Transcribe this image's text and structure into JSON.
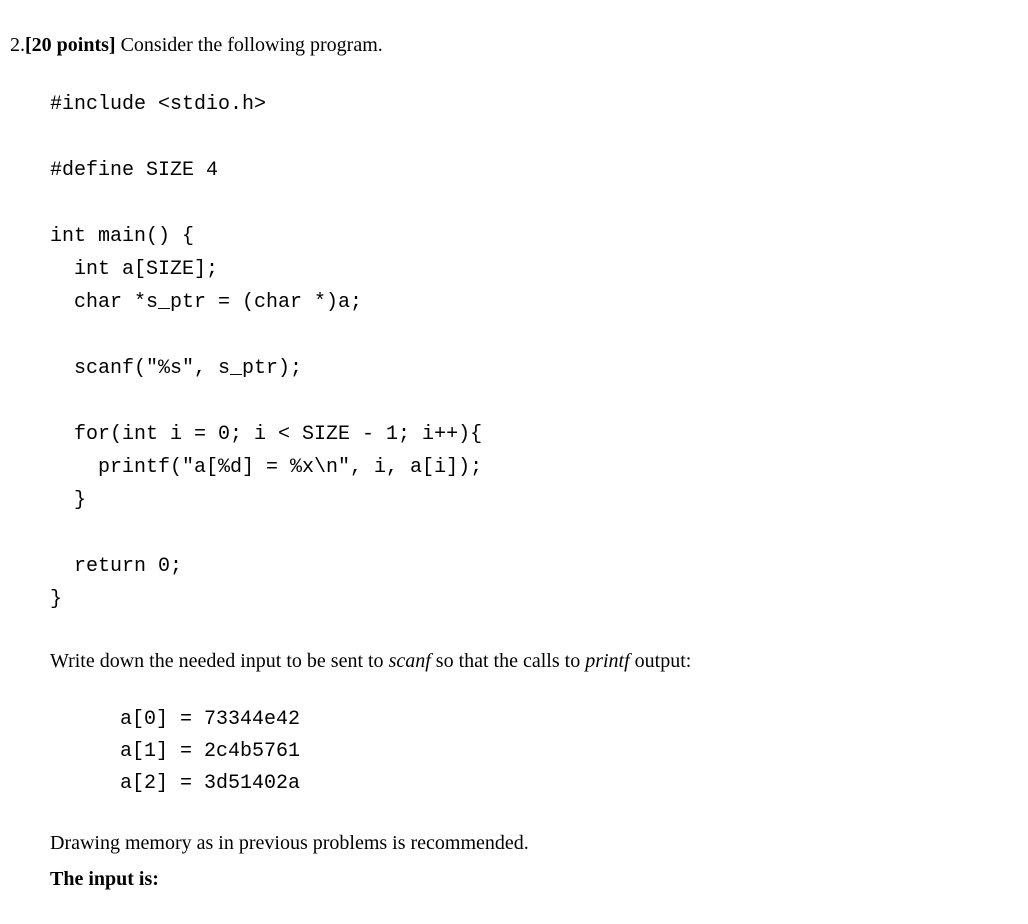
{
  "question": {
    "number": "2.",
    "points": "[20 points]",
    "intro": " Consider the following program."
  },
  "code": "#include <stdio.h>\n\n#define SIZE 4\n\nint main() {\n  int a[SIZE];\n  char *s_ptr = (char *)a;\n\n  scanf(\"%s\", s_ptr);\n\n  for(int i = 0; i < SIZE - 1; i++){\n    printf(\"a[%d] = %x\\n\", i, a[i]);\n  }\n\n  return 0;\n}",
  "prompt": {
    "before_scanf": "Write down the needed input to be sent to ",
    "scanf": "scanf",
    "between": " so that the calls to ",
    "printf": "printf",
    "after": " output:"
  },
  "output": "a[0] = 73344e42\na[1] = 2c4b5761\na[2] = 3d51402a",
  "recommend": "Drawing memory as in previous problems is recommended.",
  "input_label": "The input is:"
}
